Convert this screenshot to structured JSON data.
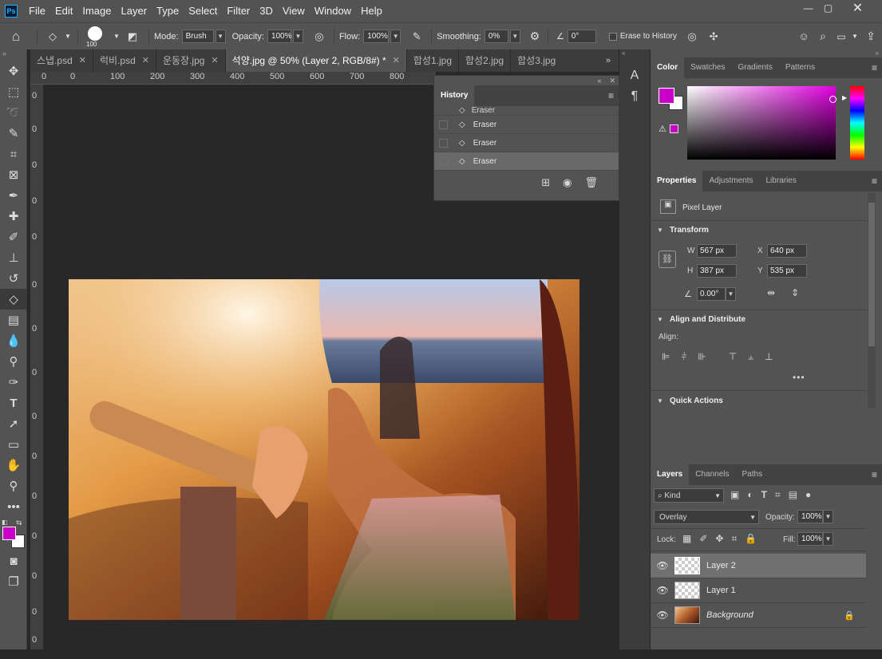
{
  "menubar": {
    "logo": "Ps",
    "items": [
      "File",
      "Edit",
      "Image",
      "Layer",
      "Type",
      "Select",
      "Filter",
      "3D",
      "View",
      "Window",
      "Help"
    ]
  },
  "optbar": {
    "brush_size": "100",
    "mode_label": "Mode:",
    "mode_value": "Brush",
    "opacity_label": "Opacity:",
    "opacity_value": "100%",
    "flow_label": "Flow:",
    "flow_value": "100%",
    "smoothing_label": "Smoothing:",
    "smoothing_value": "0%",
    "angle_value": "0°",
    "erase_to_history": "Erase to History"
  },
  "tabs": [
    {
      "label": "스냅.psd"
    },
    {
      "label": "럭비.psd"
    },
    {
      "label": "운동장.jpg"
    },
    {
      "label": "석양.jpg @ 50% (Layer 2, RGB/8#) *",
      "active": true
    },
    {
      "label": "합성1.jpg"
    },
    {
      "label": "합성2.jpg"
    },
    {
      "label": "합성3.jpg"
    }
  ],
  "ruler": {
    "top": [
      "0",
      "100",
      "200",
      "300",
      "400",
      "500",
      "600",
      "700",
      "800"
    ],
    "left": [
      "0",
      "0",
      "0",
      "0",
      "0",
      "0",
      "0",
      "0",
      "0",
      "0",
      "0",
      "0",
      "0",
      "0",
      "0",
      "0"
    ]
  },
  "history": {
    "title": "History",
    "items": [
      "Eraser",
      "Eraser",
      "Eraser",
      "Eraser"
    ]
  },
  "color_panel": {
    "tabs": [
      "Color",
      "Swatches",
      "Gradients",
      "Patterns"
    ],
    "foreground": "#c800c8",
    "background": "#ffffff"
  },
  "properties": {
    "tabs": [
      "Properties",
      "Adjustments",
      "Libraries"
    ],
    "kind": "Pixel Layer",
    "transform_label": "Transform",
    "w_label": "W",
    "w_value": "567 px",
    "h_label": "H",
    "h_value": "387 px",
    "x_label": "X",
    "x_value": "640 px",
    "y_label": "Y",
    "y_value": "535 px",
    "angle_value": "0.00°",
    "align_label": "Align and Distribute",
    "align_sub": "Align:",
    "quick_actions": "Quick Actions"
  },
  "layers": {
    "tabs": [
      "Layers",
      "Channels",
      "Paths"
    ],
    "kind_label": "Kind",
    "blend_mode": "Overlay",
    "opacity_label": "Opacity:",
    "opacity_value": "100%",
    "lock_label": "Lock:",
    "fill_label": "Fill:",
    "fill_value": "100%",
    "items": [
      {
        "name": "Layer 2",
        "selected": true
      },
      {
        "name": "Layer 1"
      },
      {
        "name": "Background",
        "locked": true
      }
    ]
  }
}
